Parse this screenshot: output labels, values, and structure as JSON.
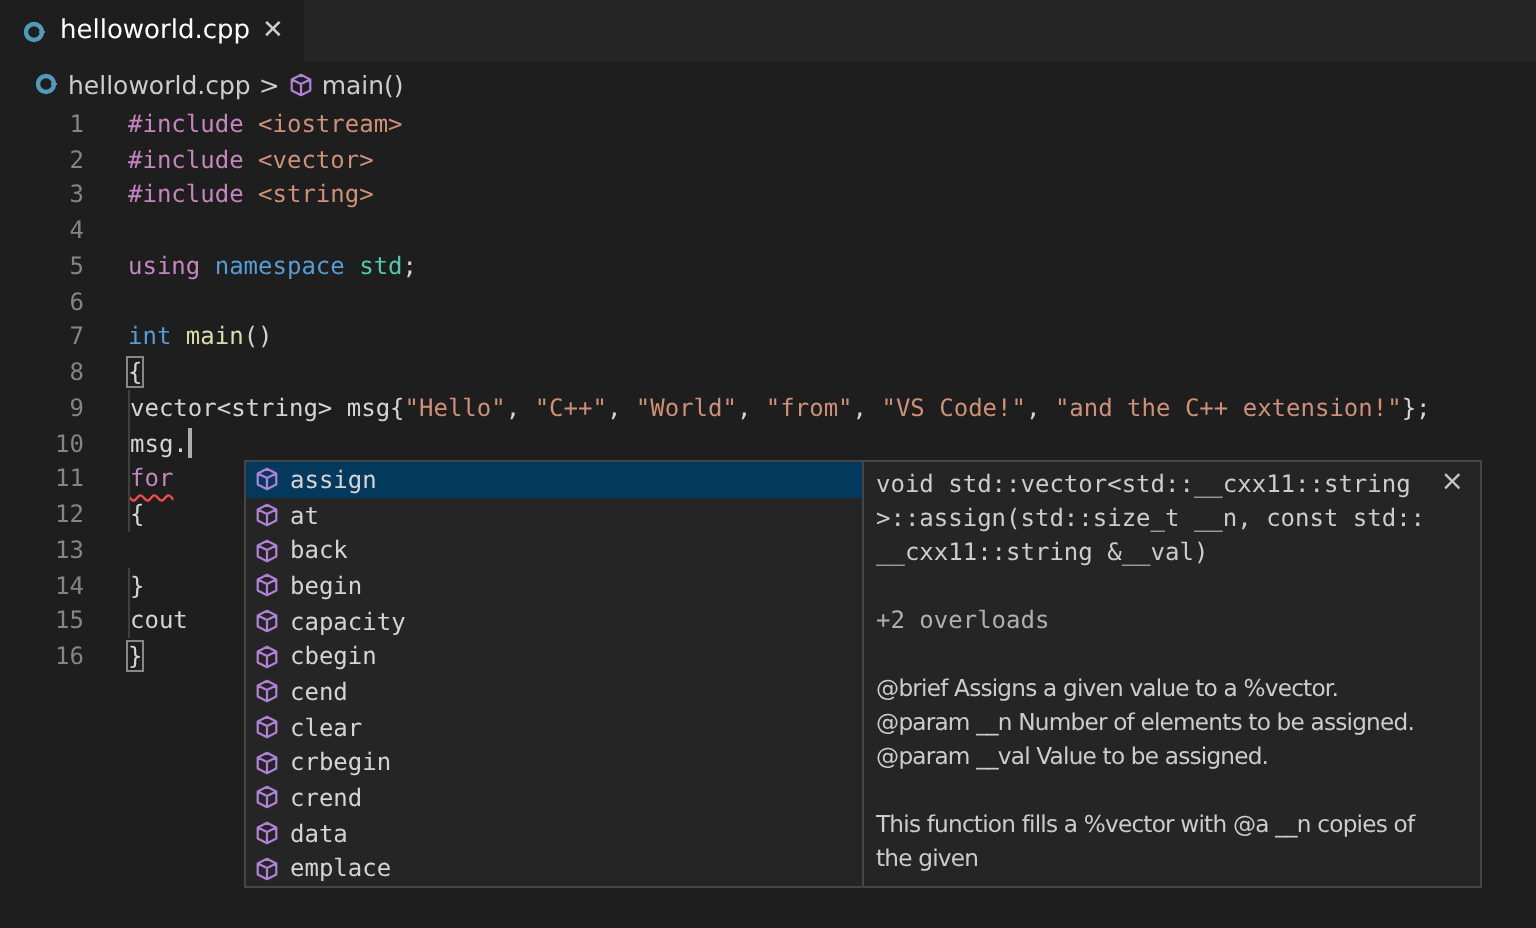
{
  "tabs": [
    {
      "label": "helloworld.cpp",
      "close": "✕",
      "selected": true
    }
  ],
  "breadcrumb": [
    {
      "kind": "file",
      "label": "helloworld.cpp"
    },
    {
      "kind": "symbol",
      "label": "main()"
    }
  ],
  "breadcrumb_separator": ">",
  "lines": [
    {
      "number": "1",
      "tokens": [
        {
          "kind": "keyword",
          "text": "#include"
        },
        {
          "kind": "string",
          "text": " <iostream>"
        }
      ]
    },
    {
      "number": "2",
      "tokens": [
        {
          "kind": "keyword",
          "text": "#include"
        },
        {
          "kind": "string",
          "text": " <vector>"
        }
      ]
    },
    {
      "number": "3",
      "tokens": [
        {
          "kind": "keyword",
          "text": "#include"
        },
        {
          "kind": "string",
          "text": " <string>"
        }
      ]
    },
    {
      "number": "4"
    },
    {
      "number": "5",
      "tokens": [
        {
          "kind": "keyword",
          "text": "using"
        },
        {
          "kind": "storage",
          "text": " namespace"
        },
        {
          "kind": "namespace",
          "text": " std"
        },
        {
          "kind": "plain",
          "text": ";"
        }
      ]
    },
    {
      "number": "6"
    },
    {
      "number": "7",
      "tokens": [
        {
          "kind": "storage",
          "text": "int"
        },
        {
          "kind": "function",
          "text": " main"
        },
        {
          "kind": "plain",
          "text": "()"
        }
      ]
    },
    {
      "number": "8",
      "tokens": [
        {
          "kind": "plain",
          "text": "{",
          "matched": true
        }
      ]
    },
    {
      "number": "9",
      "tokens": [
        {
          "kind": "plain",
          "text": "    vector<string> msg{"
        },
        {
          "kind": "string",
          "text": "\"Hello\""
        },
        {
          "kind": "plain",
          "text": ", "
        },
        {
          "kind": "string",
          "text": "\"C++\""
        },
        {
          "kind": "plain",
          "text": ", "
        },
        {
          "kind": "string",
          "text": "\"World\""
        },
        {
          "kind": "plain",
          "text": ", "
        },
        {
          "kind": "string",
          "text": "\"from\""
        },
        {
          "kind": "plain",
          "text": ", "
        },
        {
          "kind": "string",
          "text": "\"VS Code!\""
        },
        {
          "kind": "plain",
          "text": ", "
        },
        {
          "kind": "string",
          "text": "\"and the C++ extension!\""
        },
        {
          "kind": "plain",
          "text": "};"
        }
      ]
    },
    {
      "number": "10",
      "cursor": true,
      "tokens": [
        {
          "kind": "plain",
          "text": "    msg."
        }
      ]
    },
    {
      "number": "11",
      "tokens": [
        {
          "kind": "keyword",
          "text": "    for",
          "error": true
        }
      ]
    },
    {
      "number": "12",
      "tokens": [
        {
          "kind": "plain",
          "text": "    {"
        }
      ]
    },
    {
      "number": "13"
    },
    {
      "number": "14",
      "tokens": [
        {
          "kind": "plain",
          "text": "    }"
        }
      ]
    },
    {
      "number": "15",
      "tokens": [
        {
          "kind": "plain",
          "text": "    cout"
        }
      ]
    },
    {
      "number": "16",
      "tokens": [
        {
          "kind": "plain",
          "text": "}",
          "matched": true
        }
      ]
    }
  ],
  "suggestions": {
    "items": [
      {
        "label": "assign",
        "selected": true
      },
      {
        "label": "at",
        "selected": false
      },
      {
        "label": "back",
        "selected": false
      },
      {
        "label": "begin",
        "selected": false
      },
      {
        "label": "capacity",
        "selected": false
      },
      {
        "label": "cbegin",
        "selected": false
      },
      {
        "label": "cend",
        "selected": false
      },
      {
        "label": "clear",
        "selected": false
      },
      {
        "label": "crbegin",
        "selected": false
      },
      {
        "label": "crend",
        "selected": false
      },
      {
        "label": "data",
        "selected": false
      },
      {
        "label": "emplace",
        "selected": false
      }
    ],
    "details": {
      "close": "×",
      "signature": "void std::vector<std::__cxx11::string >::assign(std::size_t __n, const std::__cxx11::string &__val)",
      "overloads": "+2 overloads",
      "doc": [
        "@brief Assigns a given value to a %vector.",
        "@param __n Number of elements to be assigned.",
        "@param __val Value to be assigned."
      ],
      "description": "This function fills a %vector with @a __n copies of the given"
    }
  }
}
